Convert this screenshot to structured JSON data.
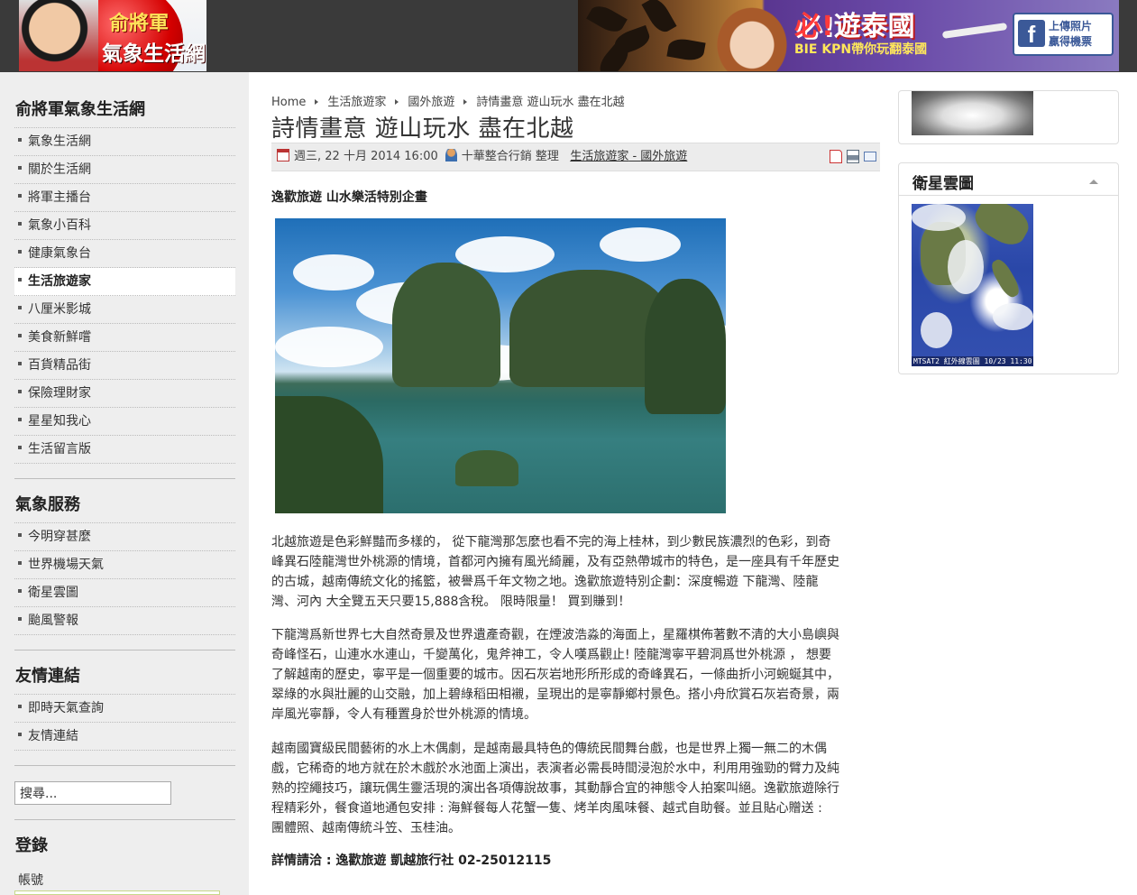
{
  "header": {
    "logo_line1": "俞將軍",
    "logo_line2": "氣象生活網",
    "banner_title_prefix": "必!",
    "banner_title": "遊泰國",
    "banner_sub": "BIE KPN帶你玩翻泰國",
    "banner_fb_line1": "上傳照片",
    "banner_fb_line2": "贏得機票"
  },
  "sidebar": {
    "menu_title": "俞將軍氣象生活網",
    "menu": [
      "氣象生活網",
      "關於生活網",
      "將軍主播台",
      "氣象小百科",
      "健康氣象台",
      "生活旅遊家",
      "八厘米影城",
      "美食新鮮嚐",
      "百貨精品街",
      "保險理財家",
      "星星知我心",
      "生活留言版"
    ],
    "weather_title": "氣象服務",
    "weather": [
      "今明穿甚麼",
      "世界機場天氣",
      "衛星雲圖",
      "颱風警報"
    ],
    "links_title": "友情連結",
    "links": [
      "即時天氣查詢",
      "友情連結"
    ],
    "search_value": "搜尋...",
    "login_title": "登錄",
    "account_label": "帳號"
  },
  "article": {
    "breadcrumb": [
      "Home",
      "生活旅遊家",
      "國外旅遊",
      "詩情畫意 遊山玩水 盡在北越"
    ],
    "title": "詩情畫意 遊山玩水 盡在北越",
    "date": "週三, 22 十月 2014 16:00",
    "author": "十華整合行銷 整理",
    "category1": "生活旅遊家",
    "category_sep": " - ",
    "category2": "國外旅遊",
    "subhead": "逸歡旅遊  山水樂活特別企畫",
    "p1": [
      "北越旅遊是色彩鮮豔而多樣的， 從下龍灣那怎麼也看不完的海上桂林，到少數民族濃烈的色彩，到奇",
      "峰異石陸龍灣世外桃源的情境，首都河內擁有風光綺麗，及有亞熱帶城市的特色，是一座具有千年歷史",
      "的古城，越南傳統文化的搖籃，被譽爲千年文物之地。逸歡旅遊特別企劃：深度暢遊 下龍灣、陸龍",
      "灣、河內 大全覽五天只要15,888含稅。 限時限量！ 買到賺到！"
    ],
    "p2": [
      "下龍灣爲新世界七大自然奇景及世界遺產奇觀，在煙波浩淼的海面上，星羅棋佈著數不清的大小島嶼與",
      "奇峰怪石，山連水水連山，千變萬化，鬼斧神工，令人嘆爲觀止! 陸龍灣寧平碧洞爲世外桃源 ， 想要",
      "了解越南的歷史，寧平是一個重要的城市。因石灰岩地形所形成的奇峰異石，一條曲折小河蜿蜒其中，",
      "翠綠的水與壯麗的山交融，加上碧綠稻田相襯，呈現出的是寧靜鄉村景色。搭小舟欣賞石灰岩奇景，兩",
      "岸風光寧靜，令人有種置身於世外桃源的情境。"
    ],
    "p3": [
      "越南國寶級民間藝術的水上木偶劇，是越南最具特色的傳統民間舞台戲，也是世界上獨一無二的木偶",
      "戲，它稀奇的地方就在於木戲於水池面上演出，表演者必需長時間浸泡於水中，利用用強勁的臂力及純",
      "熟的控繩技巧，讓玩偶生靈活現的演出各項傳說故事，其動靜合宜的神態令人拍案叫絕。逸歡旅遊除行",
      "程精彩外，餐食道地通包安排 : 海鮮餐每人花蟹一隻、烤羊肉風味餐、越式自助餐。並且貼心贈送 :",
      "  團體照、越南傳統斗笠、玉桂油。"
    ],
    "contact": "詳情請洽 : 逸歡旅遊 凱越旅行社 02-25012115"
  },
  "right": {
    "sat_title": "衛星雲圖",
    "sat_caption": "MTSAT2 紅外線雲圖  10/23 11:30"
  },
  "colors": {
    "sidebar_bg": "#eeeeee",
    "header_bg": "#3a3a3a",
    "meta_bg": "#ececec"
  }
}
